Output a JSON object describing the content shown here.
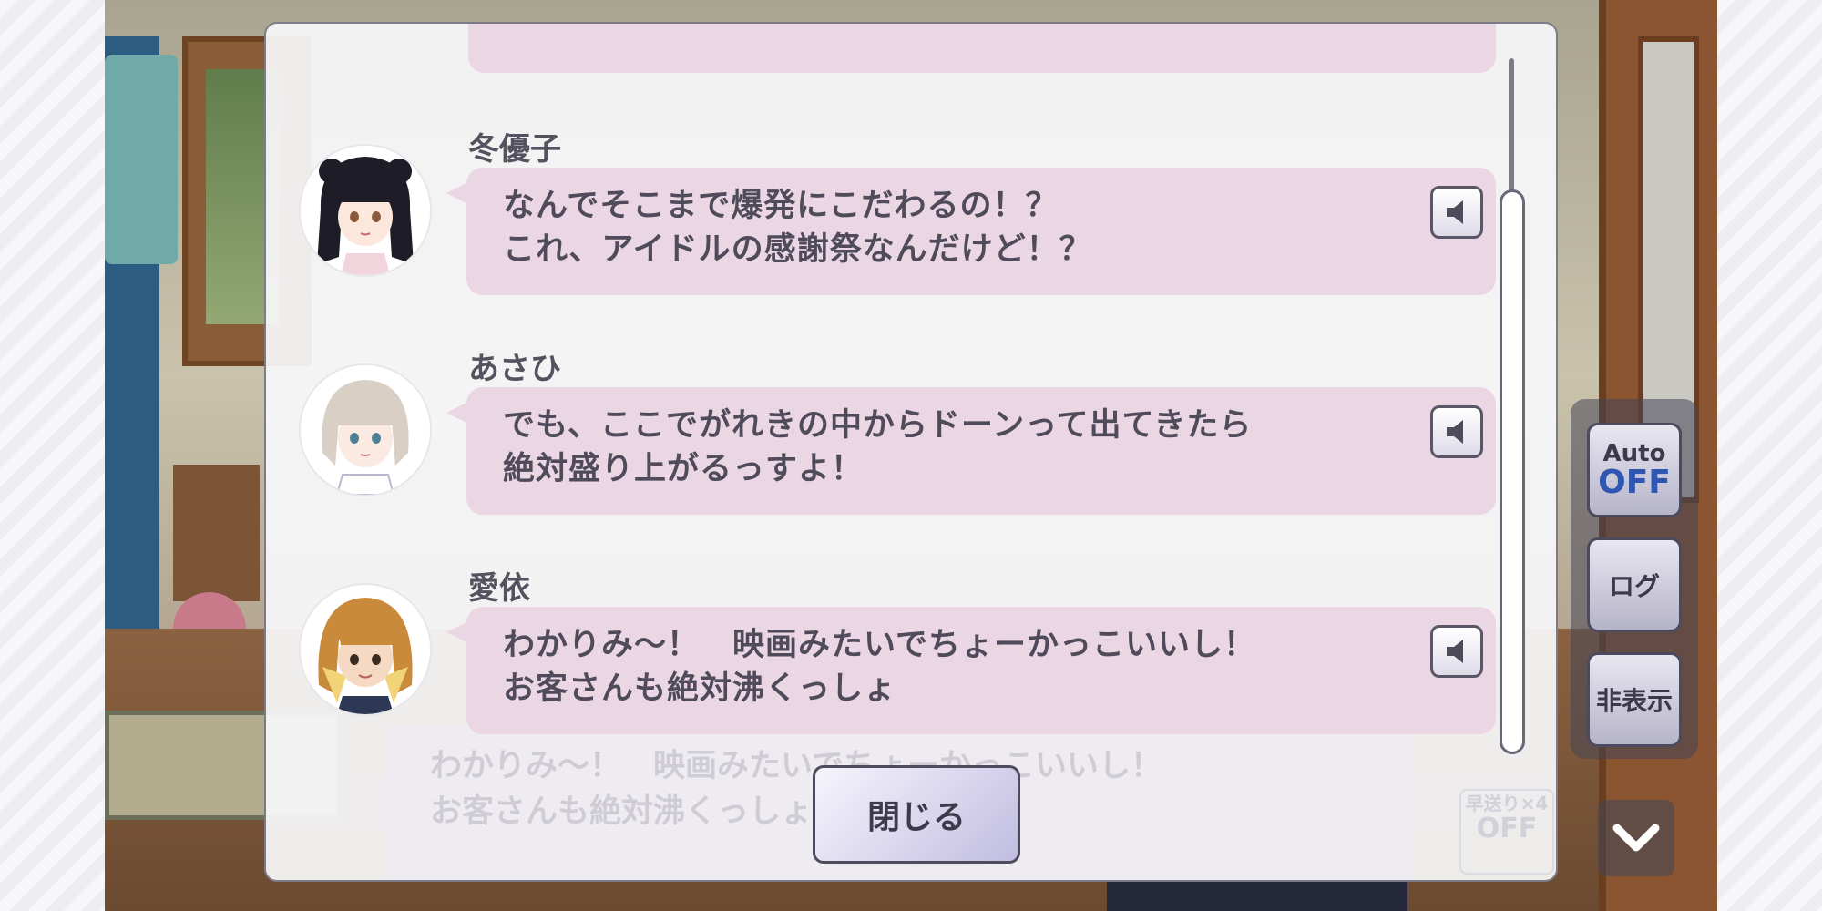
{
  "log": {
    "entries": [
      {
        "speaker": "冬優子",
        "lines": [
          "なんでそこまで爆発にこだわるの！？",
          "これ、アイドルの感謝祭なんだけど！？"
        ],
        "avatar_icon": "fuyuko-avatar"
      },
      {
        "speaker": "あさひ",
        "lines": [
          "でも、ここでがれきの中からドーンって出てきたら",
          "絶対盛り上がるっすよ！"
        ],
        "avatar_icon": "asahi-avatar"
      },
      {
        "speaker": "愛依",
        "lines": [
          "わかりみ～！　映画みたいでちょーかっこいいし！",
          "お客さんも絶対沸くっしょ"
        ],
        "avatar_icon": "mei-avatar"
      }
    ],
    "close_label": "閉じる"
  },
  "controls": {
    "auto_label": "Auto",
    "auto_state": "OFF",
    "log_label": "ログ",
    "hide_label": "非表示"
  },
  "background": {
    "ghost_lines": [
      "わかりみ～！　映画みたいでちょーかっこいいし！",
      "お客さんも絶対沸くっしょ"
    ],
    "fast_forward_label": "早送り×4",
    "fast_forward_state": "OFF"
  },
  "colors": {
    "bubble": "#ebd6e3",
    "dialog": "#f8f7fa",
    "auto_off": "#2f56b0"
  }
}
